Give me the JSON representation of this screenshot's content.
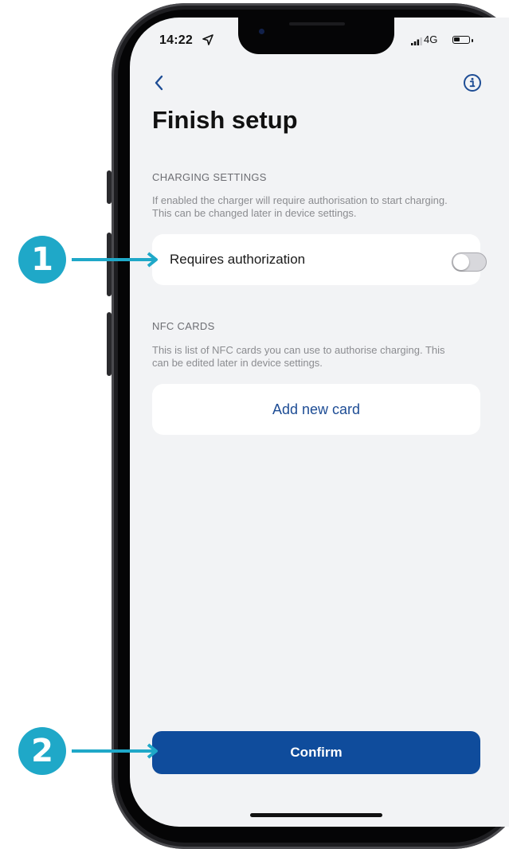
{
  "status_bar": {
    "time": "14:22",
    "network": "4G",
    "battery_level": 0.4
  },
  "nav": {
    "back_icon": "chevron-left-icon",
    "info_icon": "info-icon"
  },
  "page": {
    "title": "Finish setup"
  },
  "charging_settings": {
    "section_label": "CHARGING SETTINGS",
    "description": "If enabled the charger will require authorisation to start charging. This can be changed later in device settings.",
    "requires_authorization_label": "Requires authorization",
    "requires_authorization_enabled": false
  },
  "nfc_cards": {
    "section_label": "NFC CARDS",
    "description": "This is list of NFC cards you can use to authorise charging. This can be edited later in device settings.",
    "add_card_label": "Add new card"
  },
  "confirm_label": "Confirm",
  "callouts": [
    {
      "number": "1",
      "color": "#1fa8c8"
    },
    {
      "number": "2",
      "color": "#1fa8c8"
    }
  ],
  "colors": {
    "accent": "#0f4c9c",
    "link": "#1e4d95",
    "background": "#f2f3f5",
    "callout": "#1fa8c8"
  }
}
